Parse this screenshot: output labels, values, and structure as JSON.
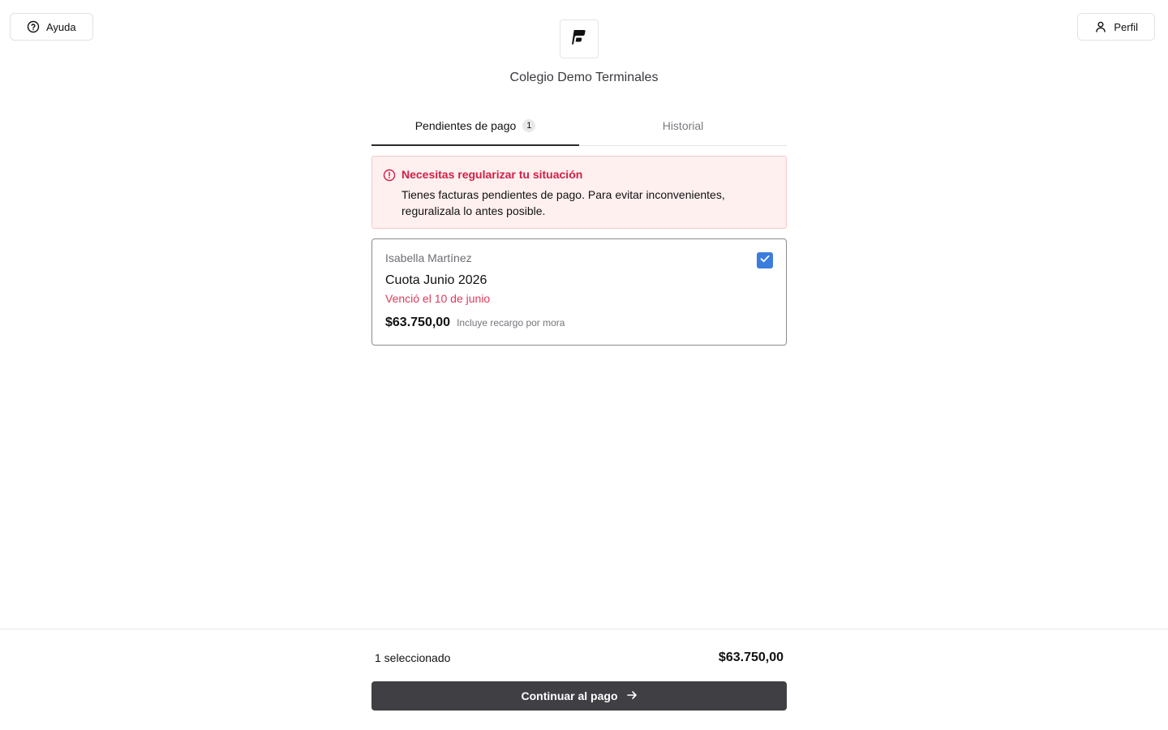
{
  "header": {
    "help_label": "Ayuda",
    "profile_label": "Perfil",
    "school_name": "Colegio Demo Terminales"
  },
  "tabs": [
    {
      "label": "Pendientes de pago",
      "badge": "1",
      "active": true
    },
    {
      "label": "Historial",
      "active": false
    }
  ],
  "alert": {
    "title": "Necesitas regularizar tu situación",
    "body": "Tienes facturas pendientes de pago. Para evitar inconvenientes, reguralizala lo antes posible."
  },
  "invoices": [
    {
      "student": "Isabella Martínez",
      "title": "Cuota Junio 2026",
      "due": "Venció el 10 de junio",
      "amount": "$63.750,00",
      "note": "Incluye recargo por mora",
      "selected": true
    }
  ],
  "footer": {
    "selected_count": "1 seleccionado",
    "total": "$63.750,00",
    "continue_label": "Continuar al pago"
  },
  "colors": {
    "accent_checkbox": "#3b7ddd",
    "alert_red": "#d21f45",
    "due_red": "#e0395a",
    "primary_button": "#3f3f44",
    "alert_bg": "#fff0f0"
  },
  "icons": {
    "help": "help-circle-icon",
    "profile": "user-icon",
    "alert": "alert-circle-icon",
    "checkbox": "check-icon",
    "continue": "arrow-right-icon",
    "logo": "brand-logo-icon"
  }
}
